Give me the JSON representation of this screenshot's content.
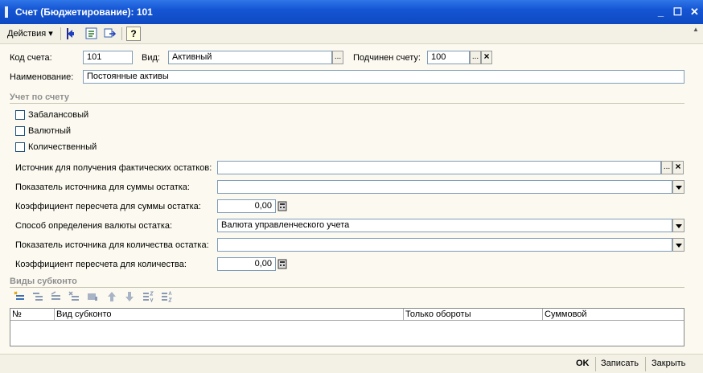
{
  "window": {
    "title": "Счет (Бюджетирование): 101",
    "minimize_glyph": "_",
    "maximize_glyph": "☐",
    "close_glyph": "✕"
  },
  "toolbar": {
    "actions_label": "Действия",
    "dropdown_glyph": "▾",
    "icons": [
      "back-arrow-icon",
      "structure-icon",
      "refresh-icon",
      "help-icon"
    ],
    "help_glyph": "?"
  },
  "form": {
    "code_label": "Код счета:",
    "code_value": "101",
    "kind_label": "Вид:",
    "kind_value": "Активный",
    "parent_label": "Подчинен счету:",
    "parent_value": "100",
    "name_label": "Наименование:",
    "name_value": "Постоянные активы",
    "select_glyph": "...",
    "clear_glyph": "×"
  },
  "accounting": {
    "section_title": "Учет по счету",
    "offbalance_label": "Забалансовый",
    "currency_label": "Валютный",
    "quantity_label": "Количественный",
    "source_label": "Источник для получения фактических остатков:",
    "source_value": "",
    "sum_indicator_label": "Показатель источника для суммы остатка:",
    "sum_indicator_value": "",
    "sum_coef_label": "Коэффициент пересчета для суммы остатка:",
    "sum_coef_value": "0,00",
    "currency_method_label": "Способ определения валюты остатка:",
    "currency_method_value": "Валюта управленческого учета",
    "qty_indicator_label": "Показатель источника для количества остатка:",
    "qty_indicator_value": "",
    "qty_coef_label": "Коэффициент пересчета для количества:",
    "qty_coef_value": "0,00"
  },
  "subconto": {
    "section_title": "Виды субконто",
    "toolbar_icons": [
      "add-row-icon",
      "copy-row-icon",
      "edit-row-icon",
      "delete-row-icon",
      "end-edit-icon",
      "move-up-icon",
      "move-down-icon",
      "sort-asc-icon",
      "sort-desc-icon"
    ],
    "columns": [
      "№",
      "Вид субконто",
      "Только обороты",
      "Суммовой"
    ],
    "rows": []
  },
  "footer": {
    "ok_label": "OK",
    "save_label": "Записать",
    "close_label": "Закрыть"
  },
  "colors": {
    "title_bar": "#1555d4",
    "form_background": "#fcfaf0",
    "section_text": "#8f8f8f"
  }
}
